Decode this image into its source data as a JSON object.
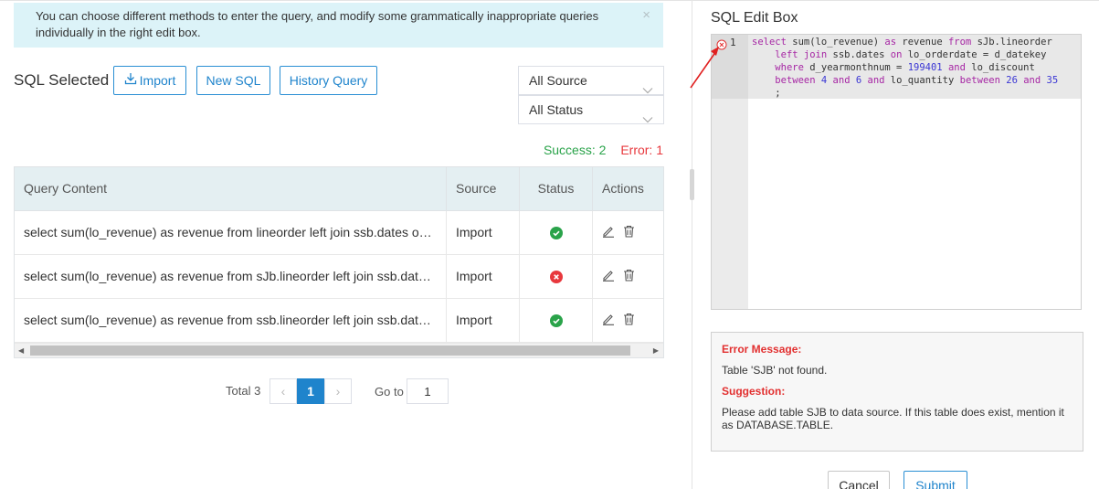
{
  "banner": {
    "text": "You can choose different methods to enter the query, and modify some grammatically inappropriate queries individually in the right edit box.",
    "close_glyph": "×"
  },
  "toolbar": {
    "title": "SQL Selected",
    "import_label": "Import",
    "new_sql_label": "New SQL",
    "history_label": "History Query"
  },
  "filters": {
    "source_value": "All Source",
    "status_value": "All Status"
  },
  "counts": {
    "success": "Success: 2",
    "error": "Error: 1"
  },
  "table": {
    "headers": [
      "Query Content",
      "Source",
      "Status",
      "Actions"
    ],
    "rows": [
      {
        "query": "select sum(lo_revenue) as revenue from lineorder left join ssb.dates on lo_orderdate = d_datekey",
        "source": "Import",
        "status": "success"
      },
      {
        "query": "select sum(lo_revenue) as revenue from sJb.lineorder left join ssb.dates on lo_orderdate = d_datekey",
        "source": "Import",
        "status": "error"
      },
      {
        "query": "select sum(lo_revenue) as revenue from ssb.lineorder left join ssb.dates on lo_orderdate = d_datekey",
        "source": "Import",
        "status": "success"
      }
    ]
  },
  "pagination": {
    "total": "Total 3",
    "current_page": "1",
    "goto_label": "Go to",
    "goto_value": "1",
    "prev_glyph": "‹",
    "next_glyph": "›"
  },
  "editor": {
    "title": "SQL Edit Box",
    "line_number": "1"
  },
  "messages": {
    "error_heading": "Error Message:",
    "error_text": "Table 'SJB' not found.",
    "suggestion_heading": "Suggestion:",
    "suggestion_text": "Please add table SJB to data source. If this table does exist, mention it as DATABASE.TABLE."
  },
  "footer": {
    "cancel_label": "Cancel",
    "submit_label": "Submit"
  },
  "colors": {
    "accent": "#1f84cc",
    "success": "#2aa34a",
    "error": "#e8383d",
    "banner_bg": "#dcf3f8"
  }
}
